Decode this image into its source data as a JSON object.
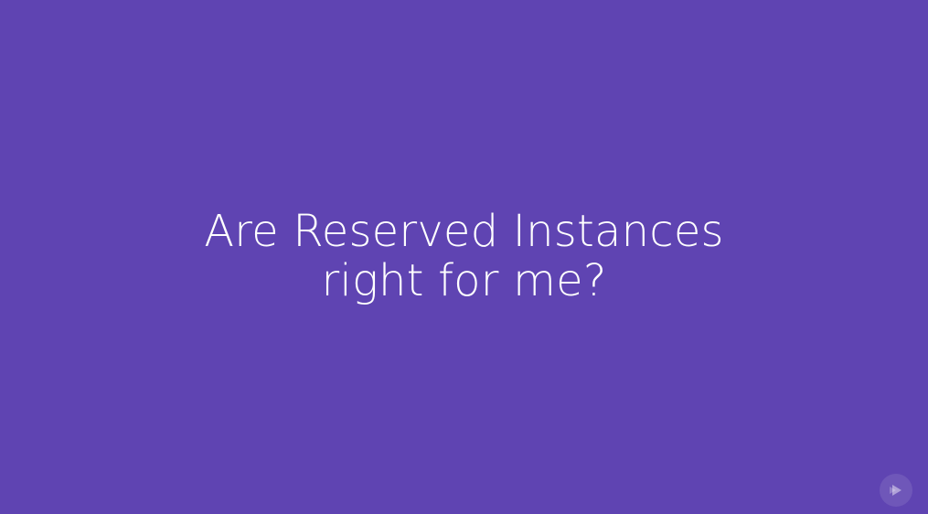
{
  "slide": {
    "title_line1": "Are Reserved Instances",
    "title_line2": "right for me?"
  },
  "colors": {
    "background": "#5f44b2",
    "title": "#ffffff"
  },
  "logo": {
    "icon": "play-logo-icon"
  }
}
